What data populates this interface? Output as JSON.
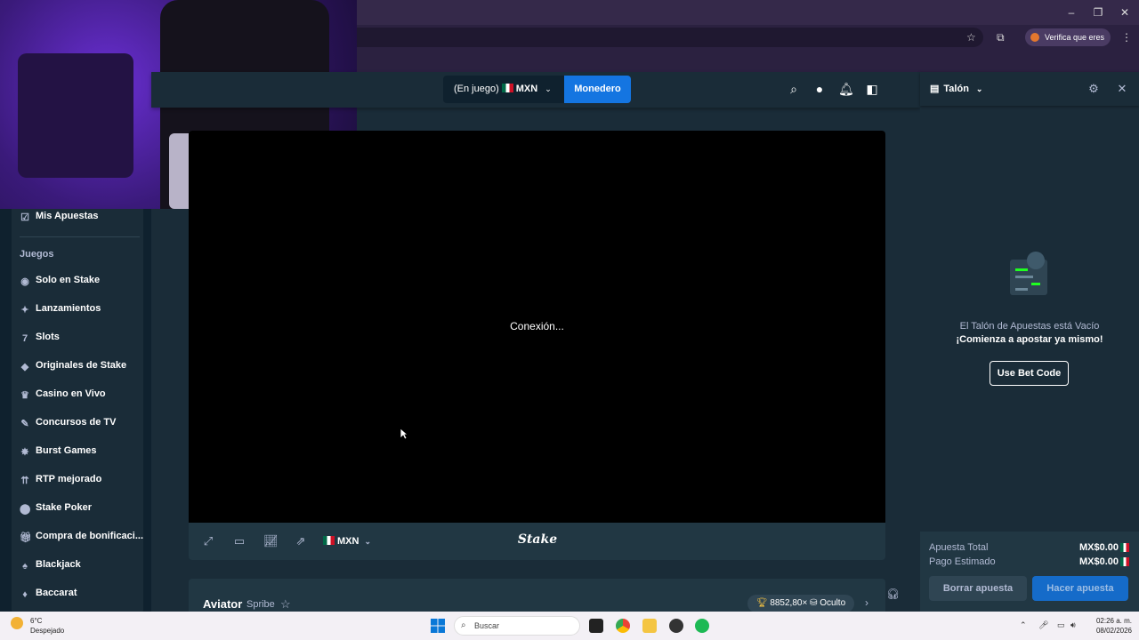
{
  "browser": {
    "verify_label": "Verifica que eres tú",
    "window_controls": [
      "minimize-icon",
      "restore-icon",
      "close-icon"
    ]
  },
  "header": {
    "balance_status": "(En juego)",
    "currency": "MXN",
    "wallet_label": "Monedero",
    "icons": [
      "search-icon",
      "user-icon",
      "bell-icon",
      "betslip-toggle-icon"
    ]
  },
  "sidebar": {
    "my_bets": "Mis Apuestas",
    "section_title": "Juegos",
    "items": [
      {
        "label": "Solo en Stake",
        "icon": "stake-icon"
      },
      {
        "label": "Lanzamientos",
        "icon": "sparkle-icon"
      },
      {
        "label": "Slots",
        "icon": "slots-icon"
      },
      {
        "label": "Originales de Stake",
        "icon": "originals-icon"
      },
      {
        "label": "Casino en Vivo",
        "icon": "live-casino-icon"
      },
      {
        "label": "Concursos de TV",
        "icon": "microphone-icon"
      },
      {
        "label": "Burst Games",
        "icon": "burst-icon"
      },
      {
        "label": "RTP mejorado",
        "icon": "rtp-icon"
      },
      {
        "label": "Stake Poker",
        "icon": "poker-icon"
      },
      {
        "label": "Compra de bonificaci...",
        "icon": "gift-icon"
      },
      {
        "label": "Blackjack",
        "icon": "blackjack-icon"
      },
      {
        "label": "Baccarat",
        "icon": "baccarat-icon"
      }
    ]
  },
  "game": {
    "loading_text": "Conexión...",
    "currency": "MXN",
    "brand": "Stake",
    "title": "Aviator",
    "provider": "Spribe",
    "stats": "8852,80× ",
    "stats_hidden": "Oculto"
  },
  "betslip": {
    "title": "Talón",
    "empty_line1": "El Talón de Apuestas está Vacío",
    "empty_line2": "¡Comienza a apostar ya mismo!",
    "bet_code_label": "Use Bet Code",
    "total_label": "Apuesta Total",
    "total_value": "MX$0.00",
    "payout_label": "Pago Estimado",
    "payout_value": "MX$0.00",
    "clear_label": "Borrar apuesta",
    "place_label": "Hacer apuesta"
  },
  "taskbar": {
    "temperature": "6°C",
    "weather": "Despejado",
    "search_placeholder": "Buscar",
    "time": "02:26 a. m.",
    "date": "08/02/2026"
  }
}
